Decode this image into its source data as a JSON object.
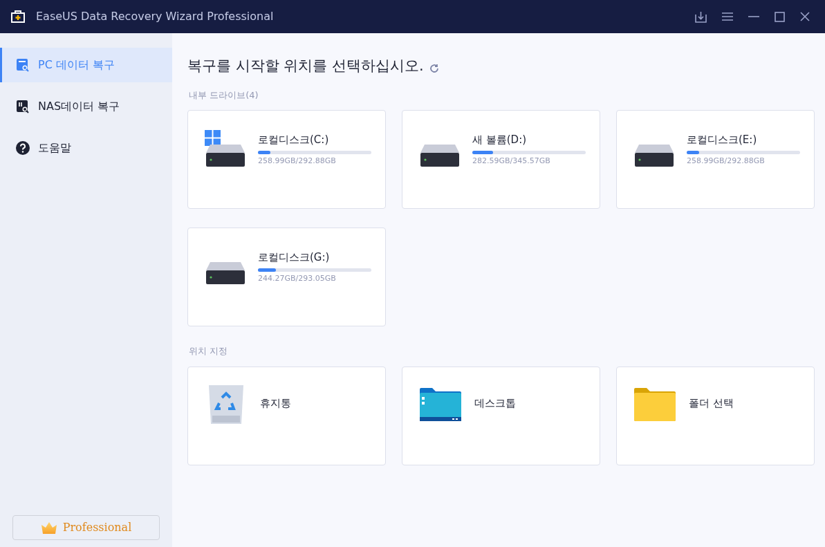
{
  "window": {
    "title": "EaseUS Data Recovery Wizard Professional"
  },
  "sidebar": {
    "items": [
      {
        "label": "PC 데이터 복구",
        "kind": "pc",
        "selected": true
      },
      {
        "label": "NAS데이터 복구",
        "kind": "nas",
        "selected": false
      },
      {
        "label": "도움말",
        "kind": "help",
        "selected": false
      }
    ],
    "edition_button": "Professional"
  },
  "heading": "복구를 시작할 위치를 선택하십시오.",
  "drives_section": {
    "label": "내부 드라이브(4)",
    "drives": [
      {
        "name": "로컬디스크(C:)",
        "system": true,
        "level": 0.11,
        "usage": "258.99GB/292.88GB"
      },
      {
        "name": "새 볼륨(D:)",
        "system": false,
        "level": 0.18,
        "usage": "282.59GB/345.57GB"
      },
      {
        "name": "로컬디스크(E:)",
        "system": false,
        "level": 0.11,
        "usage": "258.99GB/292.88GB"
      },
      {
        "name": "로컬디스크(G:)",
        "system": false,
        "level": 0.16,
        "usage": "244.27GB/293.05GB"
      }
    ]
  },
  "locations_section": {
    "label": "위치 지정",
    "locations": [
      {
        "name": "휴지통",
        "kind": "recycle"
      },
      {
        "name": "데스크톱",
        "kind": "desktop"
      },
      {
        "name": "폴더 선택",
        "kind": "folder"
      }
    ]
  }
}
